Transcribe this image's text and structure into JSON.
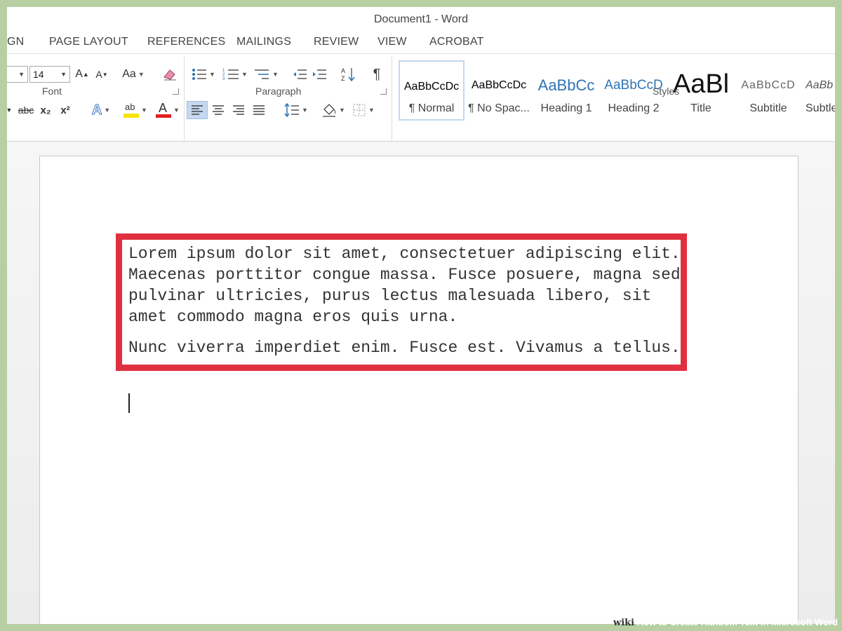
{
  "window": {
    "title": "Document1 - Word"
  },
  "tabs": [
    "GN",
    "PAGE LAYOUT",
    "REFERENCES",
    "MAILINGS",
    "REVIEW",
    "VIEW",
    "ACROBAT"
  ],
  "font": {
    "size": "14",
    "grow_label": "A",
    "shrink_label": "A",
    "case_label": "Aa",
    "strike_label": "abc",
    "sub_label": "x₂",
    "sup_label": "x²",
    "effects_label": "A",
    "highlight_label": "ab",
    "color_label": "A",
    "group_label": "Font",
    "highlight_color": "#f5e500",
    "font_color": "#e02020"
  },
  "paragraph": {
    "group_label": "Paragraph",
    "pilcrow": "¶"
  },
  "styles": {
    "group_label": "Styles",
    "items": [
      {
        "sample": "AaBbCcDc",
        "name": "¶ Normal",
        "selected": true
      },
      {
        "sample": "AaBbCcDc",
        "name": "¶ No Spac..."
      },
      {
        "sample": "AaBbCc",
        "name": "Heading 1"
      },
      {
        "sample": "AaBbCcD",
        "name": "Heading 2"
      },
      {
        "sample": "AaBl",
        "name": "Title"
      },
      {
        "sample": "AaBbCcD",
        "name": "Subtitle"
      },
      {
        "sample": "AaBb",
        "name": "Subtle"
      }
    ],
    "heading_color": "#2e74b5"
  },
  "document": {
    "paragraphs": [
      "Lorem ipsum dolor sit amet, consectetuer adipiscing elit. Maecenas porttitor congue massa. Fusce posuere, magna sed pulvinar ultricies, purus lectus malesuada libero, sit amet commodo magna eros quis urna.",
      "Nunc viverra imperdiet enim. Fusce est. Vivamus a tellus."
    ],
    "highlight_color": "#e0303f"
  },
  "watermark": {
    "brand": "wiki",
    "text": "How to Create Random Text in Microsoft Word"
  }
}
